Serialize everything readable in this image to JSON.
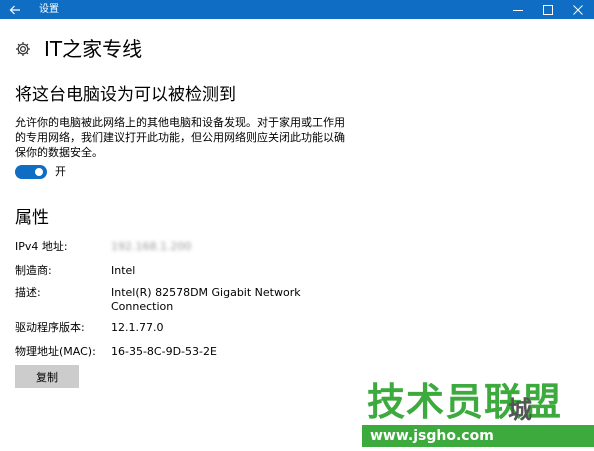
{
  "titlebar": {
    "title": "设置",
    "icons": [
      "back-arrow-icon",
      "minimize-icon",
      "maximize-icon",
      "close-icon"
    ],
    "color": "#0f6dc3"
  },
  "header": {
    "icon": "gear-icon",
    "title": "IT之家专线"
  },
  "discovery": {
    "heading": "将这台电脑设为可以被检测到",
    "description": "允许你的电脑被此网络上的其他电脑和设备发现。对于家用或工作用的专用网络，我们建议打开此功能，但公用网络则应关闭此功能以确保你的数据安全。",
    "toggle_state": true,
    "toggle_label": "开",
    "accent": "#0f6dc3"
  },
  "properties": {
    "heading": "属性",
    "items": [
      {
        "label": "IPv4 地址:",
        "value": "192.168.1.200",
        "blurred": true
      },
      {
        "label": "制造商:",
        "value": "Intel"
      },
      {
        "label": "描述:",
        "value": "Intel(R) 82578DM Gigabit Network Connection"
      },
      {
        "label": "驱动程序版本:",
        "value": "12.1.77.0"
      },
      {
        "label": "物理地址(MAC):",
        "value": "16-35-8C-9D-53-2E"
      }
    ],
    "copy_button": "复制"
  },
  "watermark": {
    "brand": "技术员联盟",
    "url": "www.jsgho.com",
    "city": "城",
    "color": "#3caa3c"
  }
}
